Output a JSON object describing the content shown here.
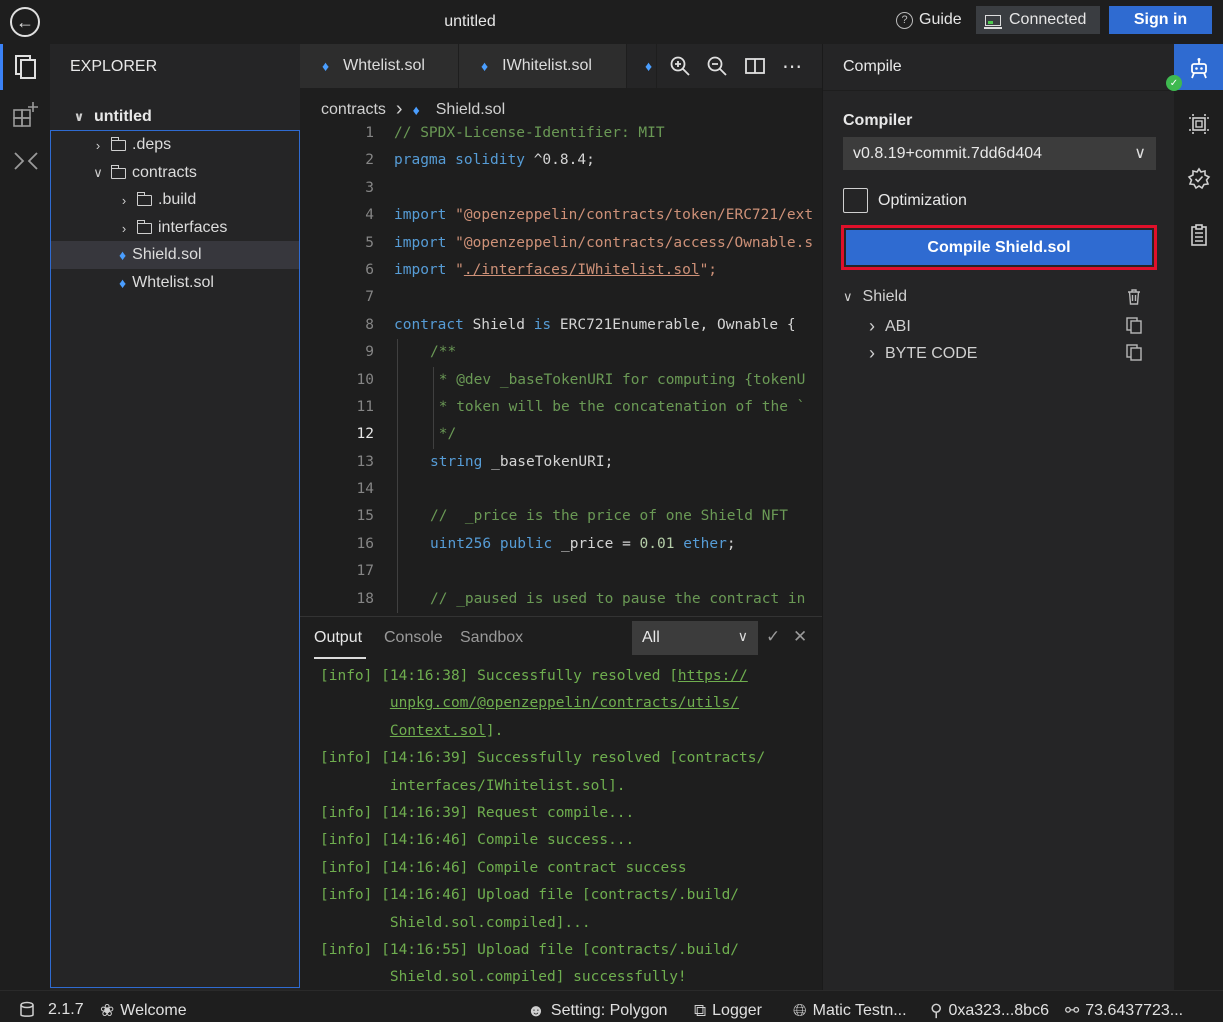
{
  "titlebar": {
    "title": "untitled",
    "guide_label": "Guide",
    "connected_label": "Connected",
    "signin_label": "Sign in"
  },
  "explorer": {
    "header": "EXPLORER",
    "root": "untitled",
    "items": [
      {
        "label": ".deps",
        "type": "folder",
        "expanded": false
      },
      {
        "label": "contracts",
        "type": "folder",
        "expanded": true
      },
      {
        "label": ".build",
        "type": "folder",
        "expanded": false
      },
      {
        "label": "interfaces",
        "type": "folder",
        "expanded": false
      },
      {
        "label": "Shield.sol",
        "type": "file",
        "selected": true
      },
      {
        "label": "Whtelist.sol",
        "type": "file"
      }
    ]
  },
  "editor": {
    "tabs": [
      "Whtelist.sol",
      "IWhitelist.sol"
    ],
    "breadcrumb": [
      "contracts",
      "Shield.sol"
    ],
    "current_line": 12,
    "lines": [
      "1",
      "2",
      "3",
      "4",
      "5",
      "6",
      "7",
      "8",
      "9",
      "10",
      "11",
      "12",
      "13",
      "14",
      "15",
      "16",
      "17",
      "18"
    ],
    "code": {
      "l1": "// SPDX-License-Identifier: MIT",
      "l2_kw1": "pragma",
      "l2_kw2": "solidity",
      "l2_rest": " ^0.8.4;",
      "l4_kw": "import",
      "l4_str": "\"@openzeppelin/contracts/token/ERC721/ext",
      "l5_kw": "import",
      "l5_str": "\"@openzeppelin/contracts/access/Ownable.s",
      "l6_kw": "import",
      "l6_q1": "\"",
      "l6_str": "./interfaces/IWhitelist.sol",
      "l6_q2": "\";",
      "l8_kw1": "contract",
      "l8_name": " Shield ",
      "l8_kw2": "is",
      "l8_rest": " ERC721Enumerable, Ownable {",
      "l9": "/**",
      "l10": " * @dev _baseTokenURI for computing {tokenU",
      "l11": " * token will be the concatenation of the `",
      "l12": " */",
      "l13_kw": "string",
      "l13_rest": " _baseTokenURI;",
      "l15": "//  _price is the price of one Shield NFT",
      "l16_kw1": "uint256",
      "l16_kw2": "public",
      "l16_mid": " _price = ",
      "l16_num": "0.01",
      "l16_kw3": "ether",
      "l16_end": ";",
      "l18": "// _paused is used to pause the contract in"
    }
  },
  "panel": {
    "tabs": [
      "Output",
      "Console",
      "Sandbox"
    ],
    "active_tab": "Output",
    "filter_value": "All",
    "logs": [
      {
        "pre": "[info] [14:16:38] Successfully resolved [",
        "link": "https://",
        "post": ""
      },
      {
        "pre": "        ",
        "link": "unpkg.com/@openzeppelin/contracts/utils/",
        "post": ""
      },
      {
        "pre": "        ",
        "link": "Context.sol",
        "post": "]."
      },
      {
        "pre": "[info] [14:16:39] Successfully resolved [contracts/",
        "link": "",
        "post": ""
      },
      {
        "pre": "        interfaces/IWhitelist.sol].",
        "link": "",
        "post": ""
      },
      {
        "pre": "[info] [14:16:39] Request compile...",
        "link": "",
        "post": ""
      },
      {
        "pre": "[info] [14:16:46] Compile success...",
        "link": "",
        "post": ""
      },
      {
        "pre": "[info] [14:16:46] Compile contract success",
        "link": "",
        "post": ""
      },
      {
        "pre": "[info] [14:16:46] Upload file [contracts/.build/",
        "link": "",
        "post": ""
      },
      {
        "pre": "        Shield.sol.compiled]...",
        "link": "",
        "post": ""
      },
      {
        "pre": "[info] [14:16:55] Upload file [contracts/.build/",
        "link": "",
        "post": ""
      },
      {
        "pre": "        Shield.sol.compiled] successfully!",
        "link": "",
        "post": ""
      }
    ]
  },
  "compile": {
    "header": "Compile",
    "compiler_label": "Compiler",
    "compiler_value": "v0.8.19+commit.7dd6d404",
    "optimization_label": "Optimization",
    "optimization_checked": false,
    "button_label": "Compile Shield.sol",
    "contract_name": "Shield",
    "abi_label": "ABI",
    "bytecode_label": "BYTE CODE"
  },
  "statusbar": {
    "version": "2.1.7",
    "welcome": "Welcome",
    "setting": "Setting: Polygon",
    "logger": "Logger",
    "network": "Matic Testn...",
    "account": "0xa323...8bc6",
    "balance": "73.6437723..."
  },
  "colors": {
    "accent": "#2f6bd1",
    "highlight_border": "#e0102a",
    "log_green": "#6fae4f"
  }
}
